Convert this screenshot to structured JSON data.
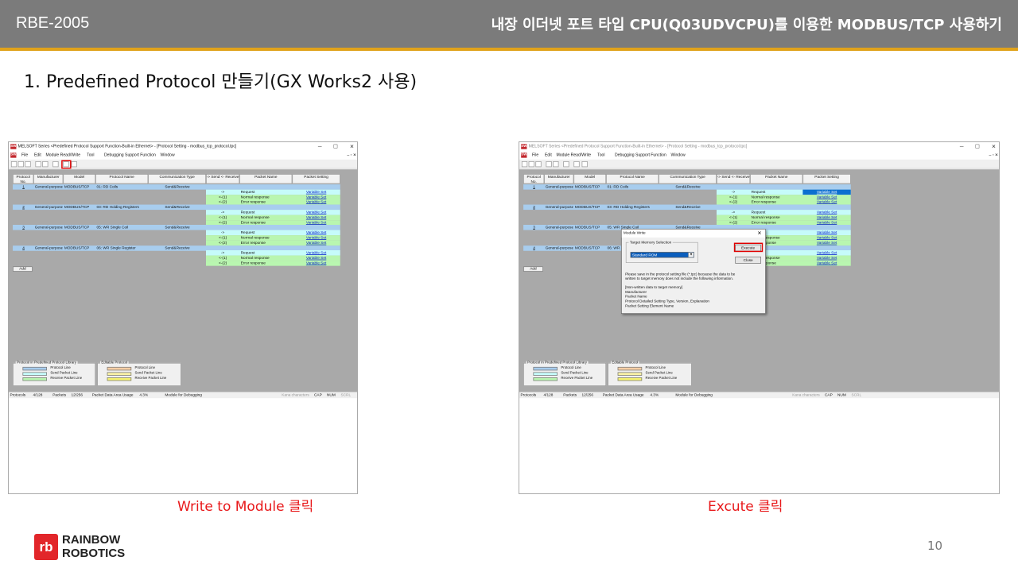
{
  "header": {
    "code": "RBE-2005",
    "title": "내장 이더넷 포트 타입 CPU(Q03UDVCPU)를 이용한 MODBUS/TCP 사용하기"
  },
  "subtitle": "1. Predefined Protocol 만들기(GX Works2 사용)",
  "window": {
    "app_icon": "MELSOFT-icon",
    "title": "MELSOFT Series <Predefined Protocol Support Function-Built-in Ethernet> - [Protocol Setting - modbus_tcp_protocol.tpc]",
    "menus": [
      "File",
      "Edit",
      "Module Read/Write",
      "Tool",
      "Debugging Support Function",
      "Window"
    ],
    "columns": [
      "Protocol No.",
      "Manufacturer",
      "Model",
      "Protocol Name",
      "Communication Type",
      "-> Send <- Receive",
      "Packet Name",
      "Packet Setting"
    ],
    "protocols": [
      {
        "no": "1",
        "manufacturer": "General-purpose",
        "model": "MODBUS/TCP",
        "name": "01: RD Coils",
        "comm": "Send&Receive"
      },
      {
        "no": "2",
        "manufacturer": "General-purpose",
        "model": "MODBUS/TCP",
        "name": "03: RD Holding Registers",
        "comm": "Send&Receive"
      },
      {
        "no": "3",
        "manufacturer": "General-purpose",
        "model": "MODBUS/TCP",
        "name": "05: WR Single Coil",
        "comm": "Send&Receive"
      },
      {
        "no": "4",
        "manufacturer": "General-purpose",
        "model": "MODBUS/TCP",
        "name": "06: WR Single Register",
        "comm": "Send&Receive"
      }
    ],
    "packets": [
      {
        "dir": "->",
        "name": "Request",
        "setting": "Variable Set"
      },
      {
        "dir": "<-(1)",
        "name": "Normal response",
        "setting": "Variable Set"
      },
      {
        "dir": "<-(2)",
        "name": "Error response",
        "setting": "Variable Set"
      }
    ],
    "add_label": "Add",
    "legend_library": {
      "title": "Protocol in Predefined Protocol Library",
      "items": [
        "Protocol Line",
        "Send Packet Line",
        "Receive Packet Line"
      ]
    },
    "legend_editable": {
      "title": "Editable Protocol",
      "items": [
        "Protocol Line",
        "Send Packet Line",
        "Receive Packet Line"
      ]
    },
    "status": {
      "protocols_label": "Protocols",
      "protocols_value": "4/128",
      "packets_label": "Packets",
      "packets_value": "12/256",
      "area_label": "Packet Data Area Usage",
      "area_value": "4.3%",
      "debug": "Module for Debugging",
      "kana": "Kana characters",
      "cap": "CAP",
      "num": "NUM",
      "scrl": "SCRL"
    }
  },
  "dialog": {
    "title": "Module Write",
    "group_label": "Target Memory Selection",
    "selected": "Standard ROM",
    "execute": "Execute",
    "close": "Close",
    "lines": [
      "Please save in the protocol setting file (*.tpc) because the data to be",
      "written to target memory does not include the following information.",
      "",
      "[Non-written data to target memory]",
      "Manufacturer",
      "Packet Name",
      "Protocol Detailed Setting Type, Version, Explanation",
      "Packet Setting Element Name"
    ]
  },
  "captions": {
    "left": "Write to Module 클릭",
    "right": "Excute 클릭"
  },
  "footer": {
    "logo_mark": "rb",
    "logo_line1": "RAINBOW",
    "logo_line2": "ROBOTICS",
    "page": "10"
  },
  "colors": {
    "header": "#7b7b7b",
    "accent": "#e0a21a",
    "protocol_line": "#a8cdee",
    "send_line": "#c6fbfa",
    "receive_line": "#b9f6b0",
    "highlight": "#e00000",
    "caption": "#e8181a"
  }
}
